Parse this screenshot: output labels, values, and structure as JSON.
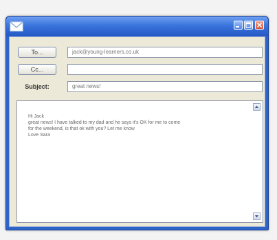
{
  "titlebar": {
    "icon": "envelope-icon",
    "buttons": {
      "minimize": "minimize-icon",
      "maximize": "maximize-icon",
      "close": "close-icon"
    }
  },
  "fields": {
    "to_label": "To...",
    "to_value": "jack@young-learners.co.uk",
    "cc_label": "Cc...",
    "cc_value": "",
    "subject_label": "Subject:",
    "subject_value": "great news!"
  },
  "body": {
    "lines": [
      "Hi Jack",
      "great news! I have talked to my dad and he says it's OK for me to come",
      "for the weekend, is that ok with you? Let me know",
      "Love Sara"
    ]
  },
  "colors": {
    "titlebar": "#2e64c8",
    "client": "#ece9d8"
  }
}
